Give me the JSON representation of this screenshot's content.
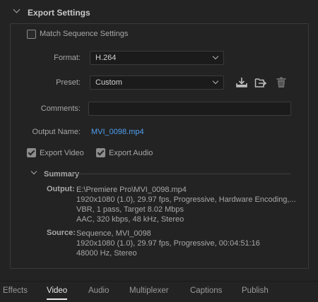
{
  "section": {
    "title": "Export Settings"
  },
  "match_sequence": {
    "label": "Match Sequence Settings",
    "checked": false
  },
  "format": {
    "label": "Format:",
    "value": "H.264"
  },
  "preset": {
    "label": "Preset:",
    "value": "Custom"
  },
  "comments": {
    "label": "Comments:",
    "value": ""
  },
  "output_name": {
    "label": "Output Name:",
    "value": "MVI_0098.mp4"
  },
  "export_video": {
    "label": "Export Video",
    "checked": true
  },
  "export_audio": {
    "label": "Export Audio",
    "checked": true
  },
  "summary": {
    "title": "Summary",
    "output": {
      "key": "Output:",
      "lines": [
        "E:\\Premiere Pro\\MVI_0098.mp4",
        "1920x1080 (1.0), 29.97 fps, Progressive, Hardware Encoding,...",
        "VBR, 1 pass, Target 8.02 Mbps",
        "AAC, 320 kbps, 48 kHz, Stereo"
      ]
    },
    "source": {
      "key": "Source:",
      "lines": [
        "Sequence, MVI_0098",
        "1920x1080 (1.0), 29.97 fps, Progressive, 00:04:51:16",
        "48000 Hz, Stereo"
      ]
    }
  },
  "tabs": [
    {
      "label": "Effects",
      "active": false
    },
    {
      "label": "Video",
      "active": true
    },
    {
      "label": "Audio",
      "active": false
    },
    {
      "label": "Multiplexer",
      "active": false
    },
    {
      "label": "Captions",
      "active": false
    },
    {
      "label": "Publish",
      "active": false
    }
  ],
  "colors": {
    "background": "#232323",
    "link": "#4f9ff0",
    "active_tab": "#e8e8e8"
  }
}
